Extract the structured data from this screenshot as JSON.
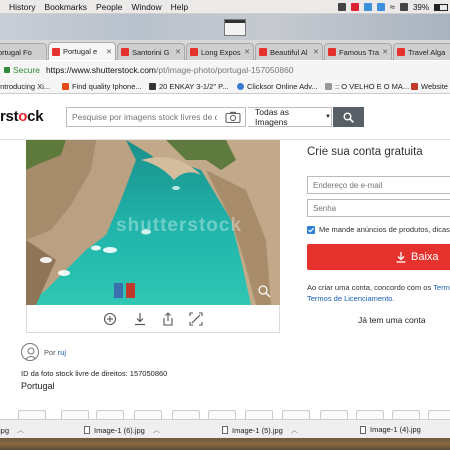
{
  "menubar": {
    "items": [
      "History",
      "Bookmarks",
      "People",
      "Window",
      "Help"
    ],
    "battery": "39%"
  },
  "tabs": [
    {
      "label": "ortugal Fo"
    },
    {
      "label": "Portugal e"
    },
    {
      "label": "Santorini G"
    },
    {
      "label": "Long Expos"
    },
    {
      "label": "Beautiful Al"
    },
    {
      "label": "Famous Tra"
    },
    {
      "label": "Travel Alga"
    }
  ],
  "address": {
    "secure_label": "Secure",
    "host": "https://www.shutterstock.com",
    "path": "/pt/image-photo/portugal-157050860"
  },
  "bookmarks": [
    {
      "label": "Introducing Xi..."
    },
    {
      "label": "Find quality Iphone..."
    },
    {
      "label": "20 ENKAY 3-1/2\" P..."
    },
    {
      "label": "Clicksor Online Adv..."
    },
    {
      "label": ":: O VELHO E O MA..."
    },
    {
      "label": "Website R"
    }
  ],
  "site": {
    "logo_prefix": "rst",
    "logo_o": "o",
    "logo_suffix": "ck",
    "search_placeholder": "Pesquise por imagens stock livres de dire",
    "search_scope": "Todas as Imagens",
    "watermark": "shutterstock"
  },
  "signup": {
    "title": "Crie sua conta gratuita",
    "email_placeholder": "Endereço de e-mail",
    "password_placeholder": "Senha",
    "checkbox_label": "Me mande anúncios de produtos, dicas e pr",
    "download_label": "Baixa",
    "terms_line1": "Ao criar uma conta, concordo com os ",
    "terms_link1": "Termos de",
    "terms_line2": "Termos de Licenciamento.",
    "already": "Já tem uma conta"
  },
  "photo": {
    "author_prefix": "Por ",
    "author_name": "ruj",
    "id_text": "ID da foto stock livre de direitos: 157050860",
    "location": "Portugal"
  },
  "downloads": [
    {
      "label": "jpg"
    },
    {
      "label": "Image-1 (6).jpg"
    },
    {
      "label": "Image-1 (5).jpg"
    },
    {
      "label": "Image-1 (4).jpg"
    }
  ],
  "colors": {
    "brand_red": "#e5322d",
    "link_blue": "#1a5fb4",
    "secure_green": "#2e8b3a"
  }
}
